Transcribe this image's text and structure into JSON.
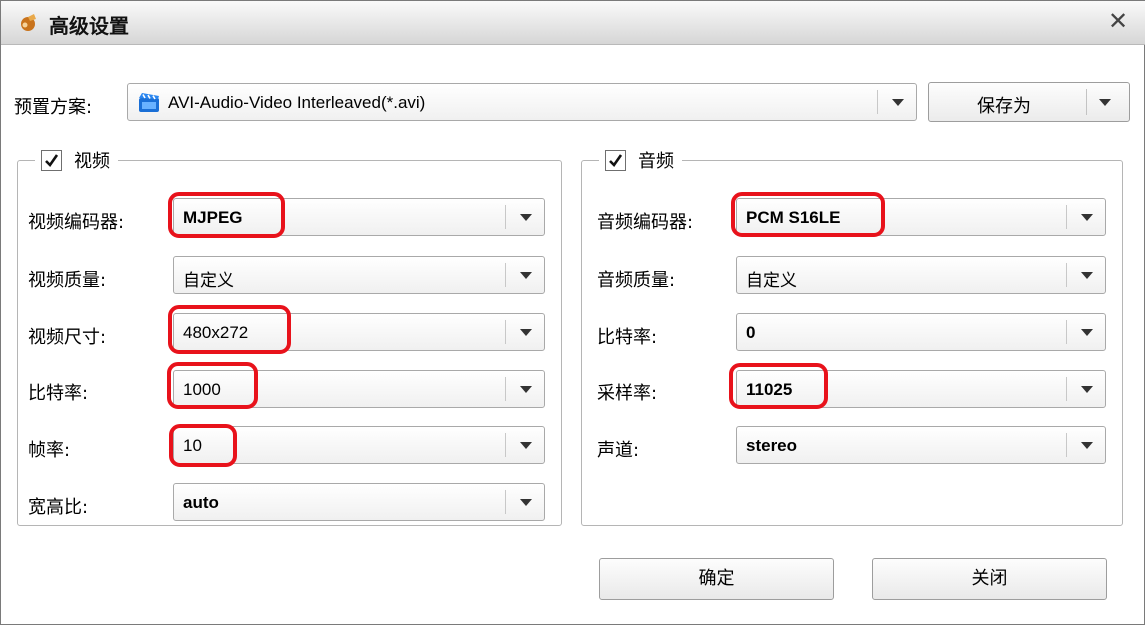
{
  "window": {
    "title": "高级设置",
    "close_glyph": "✕",
    "icon": "app-icon"
  },
  "preset": {
    "label": "预置方案:",
    "value": "AVI-Audio-Video Interleaved(*.avi)",
    "icon": "video-clapper-icon",
    "save_as_label": "保存为"
  },
  "video": {
    "checked": true,
    "title": "视频",
    "fields": [
      {
        "label": "视频编码器:",
        "value": "MJPEG",
        "highlighted": true
      },
      {
        "label": "视频质量:",
        "value": "自定义",
        "highlighted": false
      },
      {
        "label": "视频尺寸:",
        "value": "480x272",
        "highlighted": true
      },
      {
        "label": "比特率:",
        "value": "1000",
        "highlighted": true
      },
      {
        "label": "帧率:",
        "value": "10",
        "highlighted": true
      },
      {
        "label": "宽高比:",
        "value": "auto",
        "highlighted": false
      }
    ]
  },
  "audio": {
    "checked": true,
    "title": "音频",
    "fields": [
      {
        "label": "音频编码器:",
        "value": "PCM S16LE",
        "highlighted": true
      },
      {
        "label": "音频质量:",
        "value": "自定义",
        "highlighted": false
      },
      {
        "label": "比特率:",
        "value": "0",
        "highlighted": false
      },
      {
        "label": "采样率:",
        "value": "11025",
        "highlighted": true
      },
      {
        "label": "声道:",
        "value": "stereo",
        "highlighted": false
      }
    ]
  },
  "buttons": {
    "ok": "确定",
    "close": "关闭"
  },
  "colors": {
    "highlight": "#e8121b",
    "border": "#a9a9a9"
  }
}
